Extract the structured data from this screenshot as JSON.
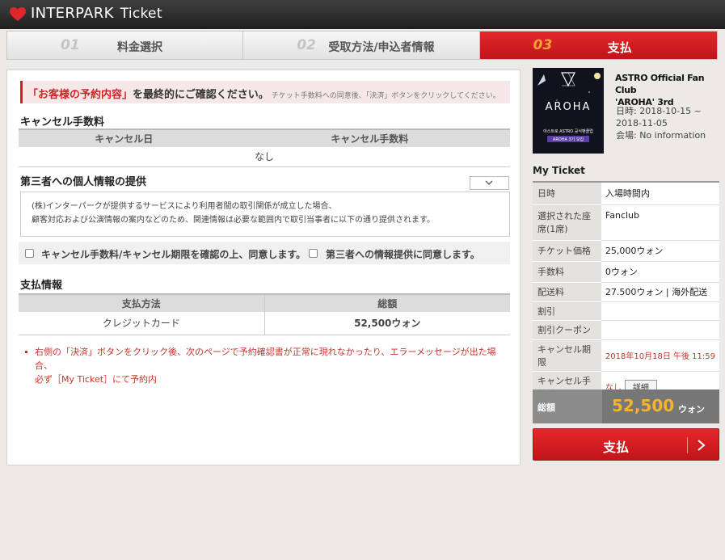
{
  "header": {
    "brand": "INTERPARK",
    "product": "Ticket"
  },
  "steps": [
    {
      "num": "01",
      "label": "料金選択"
    },
    {
      "num": "02",
      "label": "受取方法/申込者情報"
    },
    {
      "num": "03",
      "label": "支払"
    }
  ],
  "notice": {
    "highlight": "「お客様の予約内容」",
    "main": "を最終的にご確認ください。",
    "sub": "チケット手数料への同意後、「決済」ボタンをクリックしてください。"
  },
  "cancel": {
    "title": "キャンセル手数料",
    "headers": [
      "キャンセル日",
      "キャンセル手数料"
    ],
    "value": "なし"
  },
  "privacy": {
    "title": "第三者への個人情報の提供",
    "text_line1": "(株)インターパークが提供するサービスにより利用者間の取引関係が成立した場合、",
    "text_line2": "顧客対応および公演情報の案内などのため、関連情報は必要な範囲内で取引当事者に以下の通り提供されます。"
  },
  "agree": {
    "cancel_label": "キャンセル手数料/キャンセル期限を確認の上、同意します。",
    "third_label": "第三者への情報提供に同意します。"
  },
  "payment": {
    "title": "支払情報",
    "headers": [
      "支払方法",
      "総額"
    ],
    "method": "クレジットカード",
    "total": "52,500ウォン"
  },
  "warning": {
    "line1": "右側の「決済」ボタンをクリック後、次のページで予約確認書が正常に現れなかったり、エラーメッセージが出た場",
    "line2": "合、",
    "line3": "必ず［My Ticket］にて予約内"
  },
  "event": {
    "title_line1": "ASTRO Official Fan Club",
    "title_line2": "'AROHA' 3rd",
    "date_line1": "日時: 2018-10-15 ~",
    "date_line2": "2018-11-05",
    "venue": "会場: No information",
    "poster_main": "AROHA",
    "poster_sub1": "아스트로 ASTRO 공식팬클럽",
    "poster_sub2": "AROHA 3기 모집"
  },
  "my_ticket": {
    "title": "My Ticket",
    "rows": [
      {
        "label": "日時",
        "value": "入場時間内"
      },
      {
        "label": "選択された座席(1席)",
        "value": "Fanclub"
      },
      {
        "label": "チケット価格",
        "value": "25,000ウォン"
      },
      {
        "label": "手数料",
        "value": "0ウォン"
      },
      {
        "label": "配送料",
        "value": "27.500ウォン | 海外配送"
      },
      {
        "label": "割引",
        "value": ""
      },
      {
        "label": "割引クーポン",
        "value": ""
      },
      {
        "label": "キャンセル期限",
        "value": "2018年10月18日 午後 11:59"
      },
      {
        "label": "キャンセル手数料",
        "value": "なし"
      }
    ],
    "detail_button": "詳細",
    "total_label": "総額",
    "total_amount": "52,500",
    "total_unit": "ウォン"
  },
  "pay_button": "支払",
  "colors": {
    "accent": "#d51f26",
    "total_amount": "#f5b32f",
    "step_num_active": "#f6a23b"
  }
}
